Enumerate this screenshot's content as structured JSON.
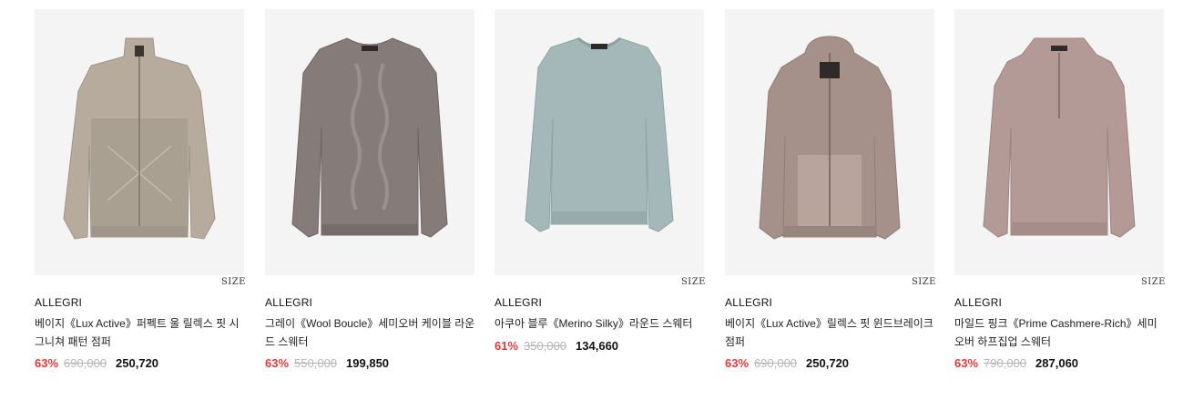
{
  "products": [
    {
      "brand": "ALLEGRI",
      "name": "베이지《Lux Active》퍼펙트 울 릴렉스 핏 시그니쳐 패턴 점퍼",
      "discount": "63%",
      "original_price": "690,000",
      "sale_price": "250,720",
      "size_label": "SIZE",
      "color": "#b6ab9c",
      "image_desc": "beige-zip-jacket-icon"
    },
    {
      "brand": "ALLEGRI",
      "name": "그레이《Wool Boucle》세미오버 케이블 라운드 스웨터",
      "discount": "63%",
      "original_price": "550,000",
      "sale_price": "199,850",
      "size_label": "",
      "color": "#857b78",
      "image_desc": "grey-cable-sweater-icon"
    },
    {
      "brand": "ALLEGRI",
      "name": "아쿠아 블루《Merino Silky》라운드 스웨터",
      "discount": "61%",
      "original_price": "350,000",
      "sale_price": "134,660",
      "size_label": "SIZE",
      "color": "#a4b8ba",
      "image_desc": "aqua-round-sweater-icon"
    },
    {
      "brand": "ALLEGRI",
      "name": "베이지《Lux Active》릴렉스 핏 윈드브레이크 점퍼",
      "discount": "63%",
      "original_price": "690,000",
      "sale_price": "250,720",
      "size_label": "SIZE",
      "color": "#a6918a",
      "image_desc": "beige-hood-zip-jumper-icon"
    },
    {
      "brand": "ALLEGRI",
      "name": "마일드 핑크《Prime Cashmere-Rich》세미오버 하프집업 스웨터",
      "discount": "63%",
      "original_price": "790,000",
      "sale_price": "287,060",
      "size_label": "SIZE",
      "color": "#b49a97",
      "image_desc": "pink-half-zip-sweater-icon"
    }
  ]
}
